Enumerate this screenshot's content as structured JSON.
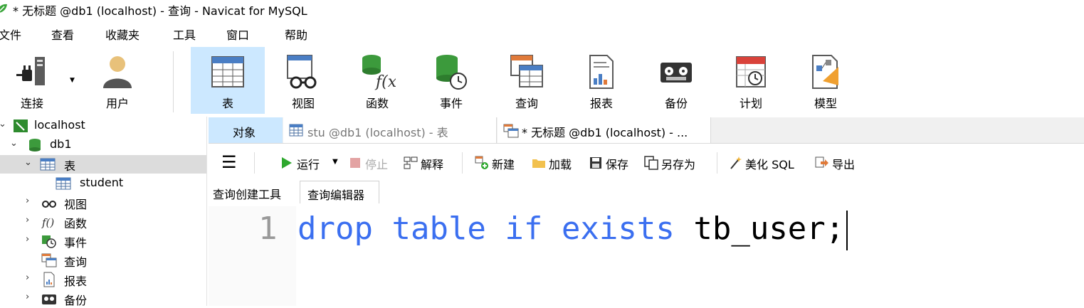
{
  "window": {
    "title": "* 无标题 @db1 (localhost) - 查询 - Navicat for MySQL"
  },
  "menu": [
    "文件",
    "查看",
    "收藏夹",
    "工具",
    "窗口",
    "帮助"
  ],
  "toolbar": {
    "connect": "连接",
    "user": "用户",
    "items": [
      "表",
      "视图",
      "函数",
      "事件",
      "查询",
      "报表",
      "备份",
      "计划",
      "模型"
    ],
    "active": "表"
  },
  "tree": {
    "connection": "localhost",
    "database": "db1",
    "tables_label": "表",
    "table": "student",
    "views": "视图",
    "functions": "函数",
    "events": "事件",
    "queries": "查询",
    "reports": "报表",
    "backups": "备份"
  },
  "tabs": {
    "objects": "对象",
    "stu": "stu @db1 (localhost) - 表",
    "query": "* 无标题 @db1 (localhost) - ..."
  },
  "query_toolbar": {
    "run": "运行",
    "stop": "停止",
    "explain": "解释",
    "new": "新建",
    "load": "加载",
    "save": "保存",
    "save_as": "另存为",
    "beautify": "美化 SQL",
    "export": "导出"
  },
  "subtabs": {
    "builder": "查询创建工具",
    "editor": "查询编辑器"
  },
  "editor": {
    "line_number": "1",
    "kw1": "drop",
    "kw2": "table",
    "kw3": "if",
    "kw4": "exists",
    "ident": "tb_user;"
  },
  "colors": {
    "accent": "#3b6ff0",
    "active_tab": "#cce8ff",
    "selected_row": "#dcdcdc"
  }
}
